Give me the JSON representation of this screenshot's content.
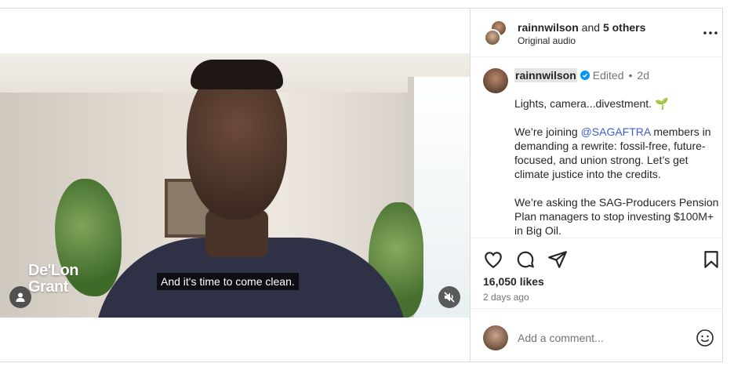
{
  "header": {
    "username": "rainnwilson",
    "joiner": " and ",
    "others": "5 others",
    "audio": "Original audio"
  },
  "video": {
    "overlay_name_line1": "De'Lon",
    "overlay_name_line2": "Grant",
    "subtitle": "And it's time to come clean."
  },
  "caption": {
    "username": "rainnwilson",
    "edited": "Edited",
    "separator": "•",
    "age": "2d",
    "line1": "Lights, camera...divestment. ",
    "line1_emoji": "🌱",
    "p2_before": "We’re joining ",
    "p2_mention": "@SAGAFTRA",
    "p2_after": " members in demanding a rewrite: fossil-free, future-focused, and union strong. Let’s get climate justice into the credits.",
    "p3": "We’re asking the SAG-Producers Pension Plan managers to stop investing $100M+ in Big Oil."
  },
  "stats": {
    "likes": "16,050 likes",
    "time": "2 days ago"
  },
  "comment_box": {
    "placeholder": "Add a comment..."
  },
  "icons": [
    "user-tag-icon",
    "mute-icon",
    "more-icon",
    "verified-icon",
    "heart-icon",
    "comment-icon",
    "share-icon",
    "bookmark-icon",
    "emoji-icon"
  ],
  "colors": {
    "mention": "#3b5ccc",
    "verified": "#0095f6",
    "muted": "#737373"
  }
}
